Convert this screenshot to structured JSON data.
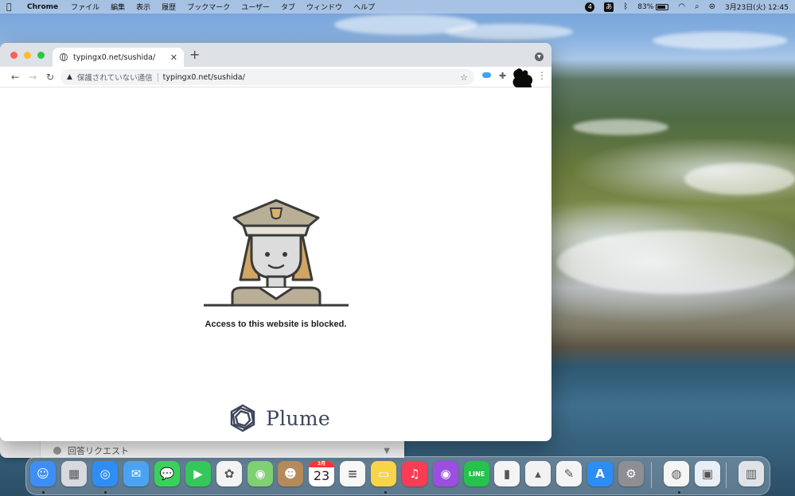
{
  "menubar": {
    "app_name": "Chrome",
    "items": [
      "ファイル",
      "編集",
      "表示",
      "履歴",
      "ブックマーク",
      "ユーザー",
      "タブ",
      "ウィンドウ",
      "ヘルプ"
    ],
    "status": {
      "badge_a": "4",
      "input_method": "あ",
      "battery_percent": "83%",
      "battery_level": 0.83,
      "datetime": "3月23日(火)  12:45"
    }
  },
  "browser": {
    "tab_title": "typingx0.net/sushida/",
    "address": {
      "security_label": "保護されていない通信",
      "url": "typingx0.net/sushida/"
    },
    "page": {
      "blocked_message": "Access to this website is blocked.",
      "brand_name": "Plume"
    }
  },
  "background_window": {
    "label": "回答リクエスト"
  },
  "dock": {
    "calendar_month": "3月",
    "calendar_day": "23",
    "icons": [
      {
        "name": "finder-icon",
        "color": "#3e8ef7"
      },
      {
        "name": "launchpad-icon",
        "color": "#d8d8df"
      },
      {
        "name": "safari-icon",
        "color": "#2f8ef4"
      },
      {
        "name": "mail-icon",
        "color": "#4aa3f2"
      },
      {
        "name": "messages-icon",
        "color": "#3ad15a"
      },
      {
        "name": "facetime-icon",
        "color": "#35c759"
      },
      {
        "name": "photos-icon",
        "color": "#f3f3f3"
      },
      {
        "name": "maps-icon",
        "color": "#7fcf73"
      },
      {
        "name": "contacts-icon",
        "color": "#b58a5a"
      },
      {
        "name": "calendar-icon",
        "color": "#ffffff"
      },
      {
        "name": "reminders-icon",
        "color": "#f7f7f7"
      },
      {
        "name": "notes-icon",
        "color": "#f8d547"
      },
      {
        "name": "music-icon",
        "color": "#fa3c55"
      },
      {
        "name": "podcasts-icon",
        "color": "#9b4ee0"
      },
      {
        "name": "line-icon",
        "color": "#27c24c"
      },
      {
        "name": "numbers-icon",
        "color": "#f4f4f4"
      },
      {
        "name": "keynote-icon",
        "color": "#f2f2f2"
      },
      {
        "name": "pages-icon",
        "color": "#f4f4f4"
      },
      {
        "name": "app-store-icon",
        "color": "#2c8df5"
      },
      {
        "name": "system-preferences-icon",
        "color": "#8e8e93"
      },
      {
        "name": "chrome-icon",
        "color": "#f5f5f5"
      },
      {
        "name": "preview-icon",
        "color": "#e8eef5"
      },
      {
        "name": "trash-icon",
        "color": "#dfe3e8"
      }
    ]
  }
}
